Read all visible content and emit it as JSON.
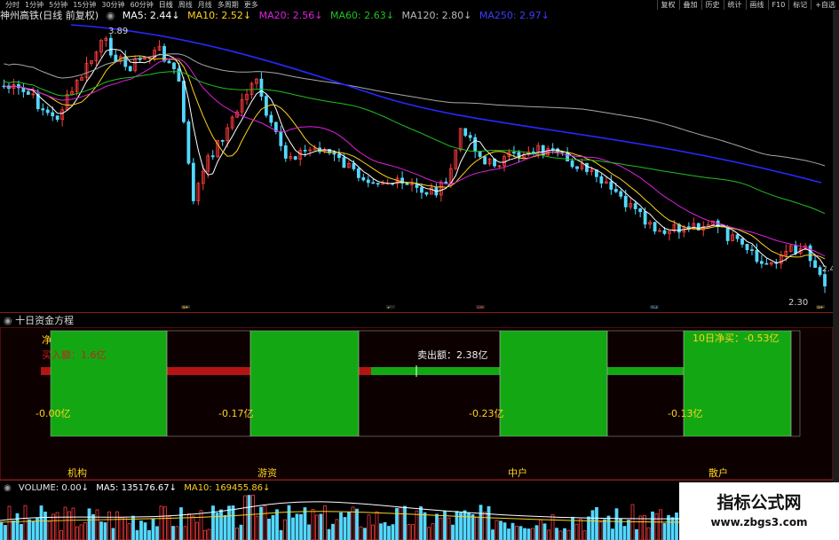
{
  "toolbar": {
    "periods": [
      "分时",
      "1分钟",
      "5分钟",
      "15分钟",
      "30分钟",
      "60分钟",
      "日线",
      "周线",
      "月线",
      "多周期",
      "更多"
    ],
    "active_period": "日线",
    "right_buttons": [
      "复权",
      "叠加",
      "历史",
      "统计",
      "画线",
      "F10",
      "标记",
      "+自选"
    ]
  },
  "header": {
    "stock": "神州高铁(日线 前复权)",
    "ma5": "MA5: 2.44↓",
    "ma10": "MA10: 2.52↓",
    "ma20": "MA20: 2.56↓",
    "ma60": "MA60: 2.63↓",
    "ma120": "MA120: 2.80↓",
    "ma250": "MA250: 2.97↓"
  },
  "colors": {
    "ma5": "#ffffff",
    "ma10": "#ffd21e",
    "ma20": "#e020e0",
    "ma60": "#20c020",
    "ma120": "#a8a8a8",
    "ma250": "#2828ff",
    "up": "#ff3c3c",
    "down": "#54d8ff",
    "fund_green": "#13a813",
    "fund_red": "#b41414"
  },
  "price_chart": {
    "high_label": "3.89",
    "low_label": "2.30",
    "right_edge_price": "2.4",
    "events": [
      "跌",
      "§",
      "增",
      "财",
      "跌"
    ]
  },
  "fund_panel": {
    "title": "十日资金方程",
    "net_prefix": "净",
    "buy_label": "买入额：1.6亿",
    "sell_label": "卖出额：2.38亿",
    "ten_day_net": "10日净买：-0.53亿",
    "groups": [
      {
        "name": "机构",
        "net": "-0.00亿"
      },
      {
        "name": "游资",
        "net": "-0.17亿"
      },
      {
        "name": "中户",
        "net": "-0.23亿"
      },
      {
        "name": "散户",
        "net": "-0.13亿"
      }
    ]
  },
  "volume": {
    "volume": "VOLUME: 0.00↓",
    "ma5": "MA5: 135176.67↓",
    "ma10": "MA10: 169455.86↓"
  },
  "watermark": {
    "title": "指标公式网",
    "url": "www.zbgs3.com"
  }
}
